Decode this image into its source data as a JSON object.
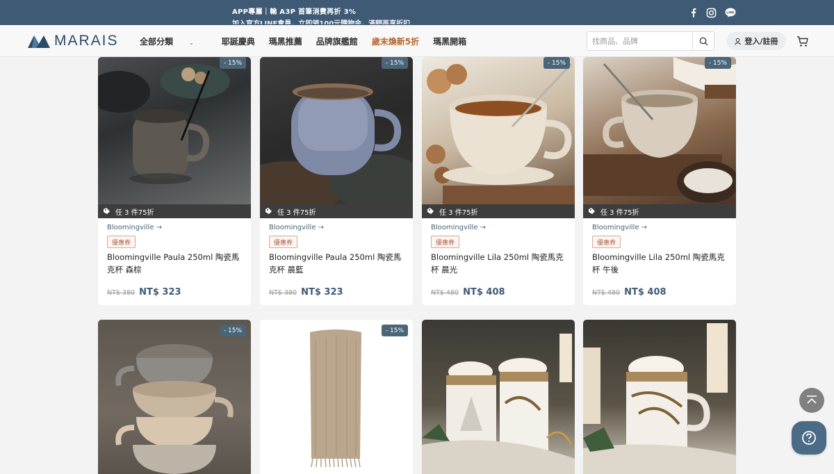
{
  "promo": {
    "line1": "APP專屬｜輸 A3P 首筆消費再折 3%",
    "line2": "加入官方LINE會員，立即領100元購物金，滿額再享折扣"
  },
  "nav": {
    "logo_text": "MARAIS",
    "menu": [
      "全部分類",
      "耶誕慶典",
      "瑪黑推薦",
      "品牌旗艦館",
      "歲末煥新5折",
      "瑪黑開箱"
    ],
    "search_placeholder": "找商品、品牌",
    "login_label": "登入/註冊"
  },
  "products": [
    {
      "discount": "- 15%",
      "bundle": "任 3 件75折",
      "brand": "Bloomingville →",
      "coupon": "優惠券",
      "name": "Bloomingville Paula 250ml 陶瓷馬克杯 森棕",
      "old_price": "NT$ 380",
      "price": "NT$ 323"
    },
    {
      "discount": "- 15%",
      "bundle": "任 3 件75折",
      "brand": "Bloomingville →",
      "coupon": "優惠券",
      "name": "Bloomingville Paula 250ml 陶瓷馬克杯 晨藍",
      "old_price": "NT$ 380",
      "price": "NT$ 323"
    },
    {
      "discount": "- 15%",
      "bundle": "任 3 件75折",
      "brand": "Bloomingville →",
      "coupon": "優惠券",
      "name": "Bloomingville Lila 250ml 陶瓷馬克杯 晨光",
      "old_price": "NT$ 480",
      "price": "NT$ 408"
    },
    {
      "discount": "- 15%",
      "bundle": "任 3 件75折",
      "brand": "Bloomingville →",
      "coupon": "優惠券",
      "name": "Bloomingville Lila 250ml 陶瓷馬克杯 午後",
      "old_price": "NT$ 480",
      "price": "NT$ 408"
    },
    {
      "discount": "- 15%"
    },
    {
      "discount": "- 15%"
    },
    {},
    {}
  ],
  "colors": {
    "promo_bar": "#3e5a75",
    "accent": "#3e5a75",
    "highlight": "#b8662d"
  }
}
